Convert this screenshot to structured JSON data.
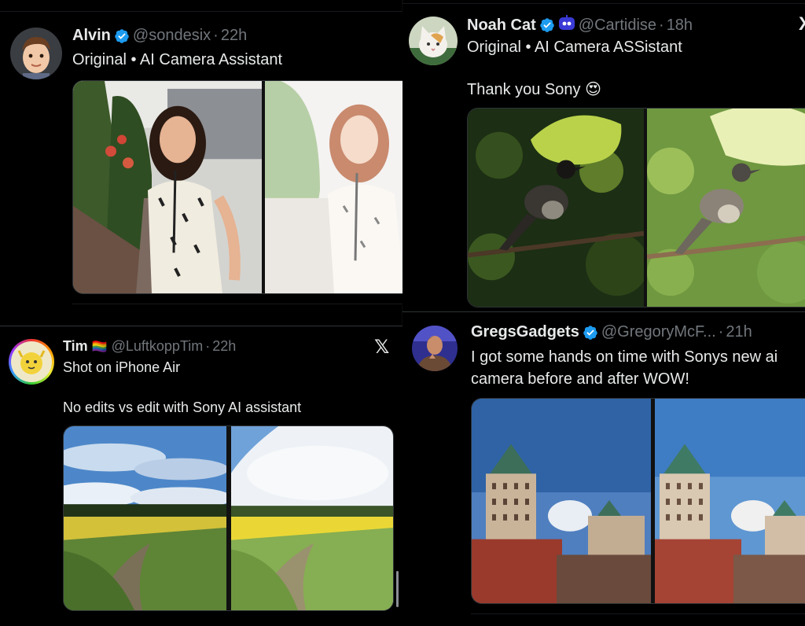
{
  "posts": {
    "alvin": {
      "name": "Alvin",
      "handle": "@sondesix",
      "time": "22h",
      "text": "Original • AI Camera Assistant"
    },
    "tim": {
      "name": "Tim",
      "flag": "🏳️‍🌈",
      "handle": "@LuftkoppTim",
      "time": "22h",
      "text_line1": "Shot on iPhone Air",
      "text_line2": "No edits vs edit with Sony AI assistant",
      "x_logo": "𝕏"
    },
    "noah": {
      "name": "Noah Cat",
      "handle": "@Cartidise",
      "time": "18h",
      "text_line1": "Original • AI Camera ASSistant",
      "text_line2": "Thank you Sony 😍",
      "x_logo": "X"
    },
    "greg": {
      "name": "GregsGadgets",
      "handle": "@GregoryMcF...",
      "time": "21h",
      "text_line1": "I got some hands on time with Sonys new ai",
      "text_line2": "camera before and after WOW!"
    }
  },
  "separator": "·",
  "colors": {
    "background": "#000000",
    "text": "#e7e9ea",
    "secondary": "#71767b",
    "verified": "#1d9bf0",
    "divider": "#2f3336"
  },
  "icons": {
    "verified": "verified-badge-icon",
    "x": "x-logo-icon",
    "bot": "bot-label-icon"
  }
}
